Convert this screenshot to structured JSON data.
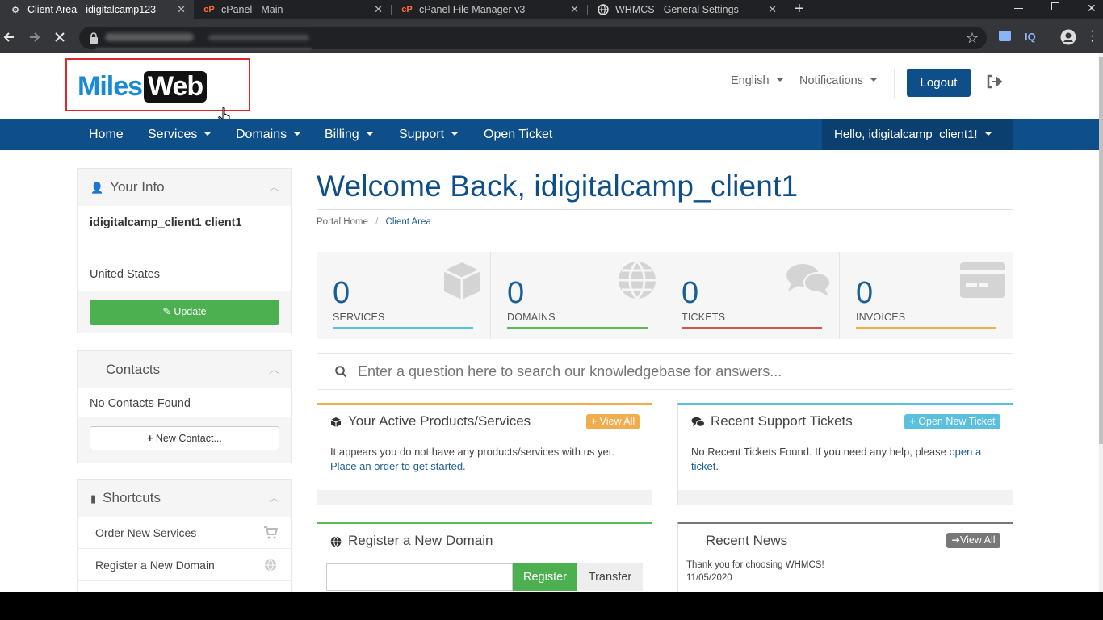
{
  "browser": {
    "tabs": [
      {
        "title": "Client Area - idigitalcamp123",
        "favicon": "whmcs-icon",
        "active": true
      },
      {
        "title": "cPanel - Main",
        "favicon": "cpanel-icon",
        "active": false
      },
      {
        "title": "cPanel File Manager v3",
        "favicon": "cpanel-icon",
        "active": false
      },
      {
        "title": "WHMCS - General Settings",
        "favicon": "globe-icon",
        "active": false
      }
    ],
    "new_tab": "+",
    "toolbar_icons": [
      "back-icon",
      "forward-icon",
      "stop-loading-icon",
      "lock-icon",
      "star-icon",
      "extension-icon",
      "iq-extension-icon",
      "profile-icon",
      "kebab-menu-icon"
    ],
    "iq_label": "IQ"
  },
  "header": {
    "logo_left": "Miles",
    "logo_right": "Web",
    "language": "English",
    "notifications": "Notifications",
    "logout": "Logout",
    "accent_color": "#0e4f8a",
    "highlight_color": "#e0272c"
  },
  "nav": {
    "items": [
      {
        "label": "Home",
        "dropdown": false
      },
      {
        "label": "Services",
        "dropdown": true
      },
      {
        "label": "Domains",
        "dropdown": true
      },
      {
        "label": "Billing",
        "dropdown": true
      },
      {
        "label": "Support",
        "dropdown": true
      },
      {
        "label": "Open Ticket",
        "dropdown": false
      }
    ],
    "user_greeting": "Hello, idigitalcamp_client1!"
  },
  "sidebar": {
    "your_info": {
      "title": "Your Info",
      "name": "idigitalcamp_client1 client1",
      "country": "United States",
      "update_button": "Update"
    },
    "contacts": {
      "title": "Contacts",
      "empty": "No Contacts Found",
      "new_button": "New Contact..."
    },
    "shortcuts": {
      "title": "Shortcuts",
      "items": [
        {
          "label": "Order New Services",
          "icon": "cart-icon"
        },
        {
          "label": "Register a New Domain",
          "icon": "globe-icon"
        }
      ]
    }
  },
  "main": {
    "title": "Welcome Back, idigitalcamp_client1",
    "breadcrumb": {
      "home": "Portal Home",
      "separator": "/",
      "current": "Client Area"
    },
    "stats": [
      {
        "value": "0",
        "label": "SERVICES",
        "color": "#5bc0de",
        "icon": "cube-icon"
      },
      {
        "value": "0",
        "label": "DOMAINS",
        "color": "#5cb85c",
        "icon": "globe-icon"
      },
      {
        "value": "0",
        "label": "TICKETS",
        "color": "#d9534f",
        "icon": "comments-icon"
      },
      {
        "value": "0",
        "label": "INVOICES",
        "color": "#f0ad4e",
        "icon": "credit-card-icon"
      }
    ],
    "search": {
      "placeholder": "Enter a question here to search our knowledgebase for answers..."
    },
    "products_panel": {
      "title": "Your Active Products/Services",
      "button": "View All",
      "text": "It appears you do not have any products/services with us yet.",
      "link": "Place an order to get started",
      "link_suffix": ".",
      "color": "#f0ad4e"
    },
    "tickets_panel": {
      "title": "Recent Support Tickets",
      "button": "Open New Ticket",
      "text": "No Recent Tickets Found. If you need any help, please",
      "link": "open a ticket",
      "link_suffix": ".",
      "color": "#5bc0de"
    },
    "domain_panel": {
      "title": "Register a New Domain",
      "register": "Register",
      "transfer": "Transfer",
      "color": "#5cb85c"
    },
    "news_panel": {
      "title": "Recent News",
      "button": "View All",
      "item_title": "Thank you for choosing WHMCS!",
      "item_date": "11/05/2020",
      "color": "#777777"
    }
  }
}
